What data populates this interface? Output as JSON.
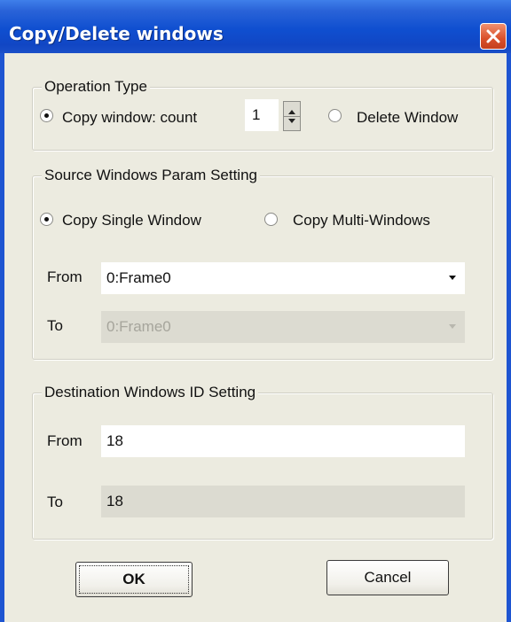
{
  "window": {
    "title": "Copy/Delete windows"
  },
  "operation": {
    "legend": "Operation Type",
    "copy_label": "Copy window: count",
    "copy_selected": true,
    "count_value": "1",
    "delete_label": "Delete Window",
    "delete_selected": false
  },
  "source": {
    "legend": "Source Windows Param Setting",
    "single_label": "Copy Single Window",
    "single_selected": true,
    "multi_label": "Copy Multi-Windows",
    "multi_selected": false,
    "from_label": "From",
    "from_value": "0:Frame0",
    "to_label": "To",
    "to_value": "0:Frame0"
  },
  "destination": {
    "legend": "Destination Windows ID Setting",
    "from_label": "From",
    "from_value": "18",
    "to_label": "To",
    "to_value": "18"
  },
  "buttons": {
    "ok_label": "OK",
    "cancel_label": "Cancel"
  }
}
